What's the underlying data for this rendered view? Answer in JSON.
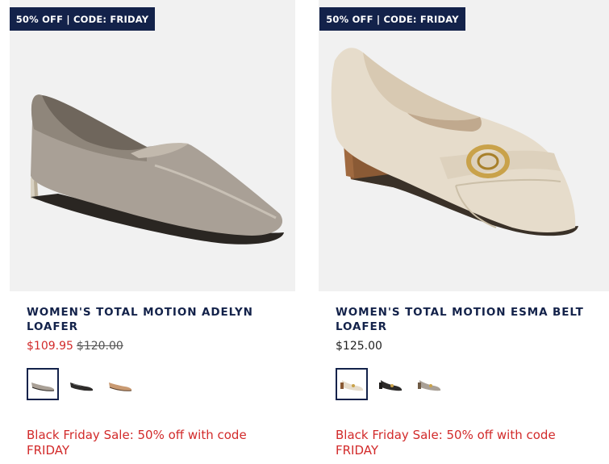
{
  "products": [
    {
      "badge": "50% OFF | CODE: FRIDAY",
      "title": "WOMEN'S TOTAL MOTION ADELYN LOAFER",
      "sale_price": "$109.95",
      "original_price": "$120.00",
      "promo": "Black Friday Sale: 50% off with code FRIDAY",
      "swatches": [
        "taupe",
        "black",
        "tan"
      ]
    },
    {
      "badge": "50% OFF | CODE: FRIDAY",
      "title": "WOMEN'S TOTAL MOTION ESMA BELT LOAFER",
      "price": "$125.00",
      "promo": "Black Friday Sale: 50% off with code FRIDAY",
      "swatches": [
        "ivory",
        "black",
        "taupe"
      ]
    }
  ],
  "colors": {
    "navy": "#13224a",
    "sale_red": "#d22a2a",
    "image_bg": "#f1f1f1"
  }
}
